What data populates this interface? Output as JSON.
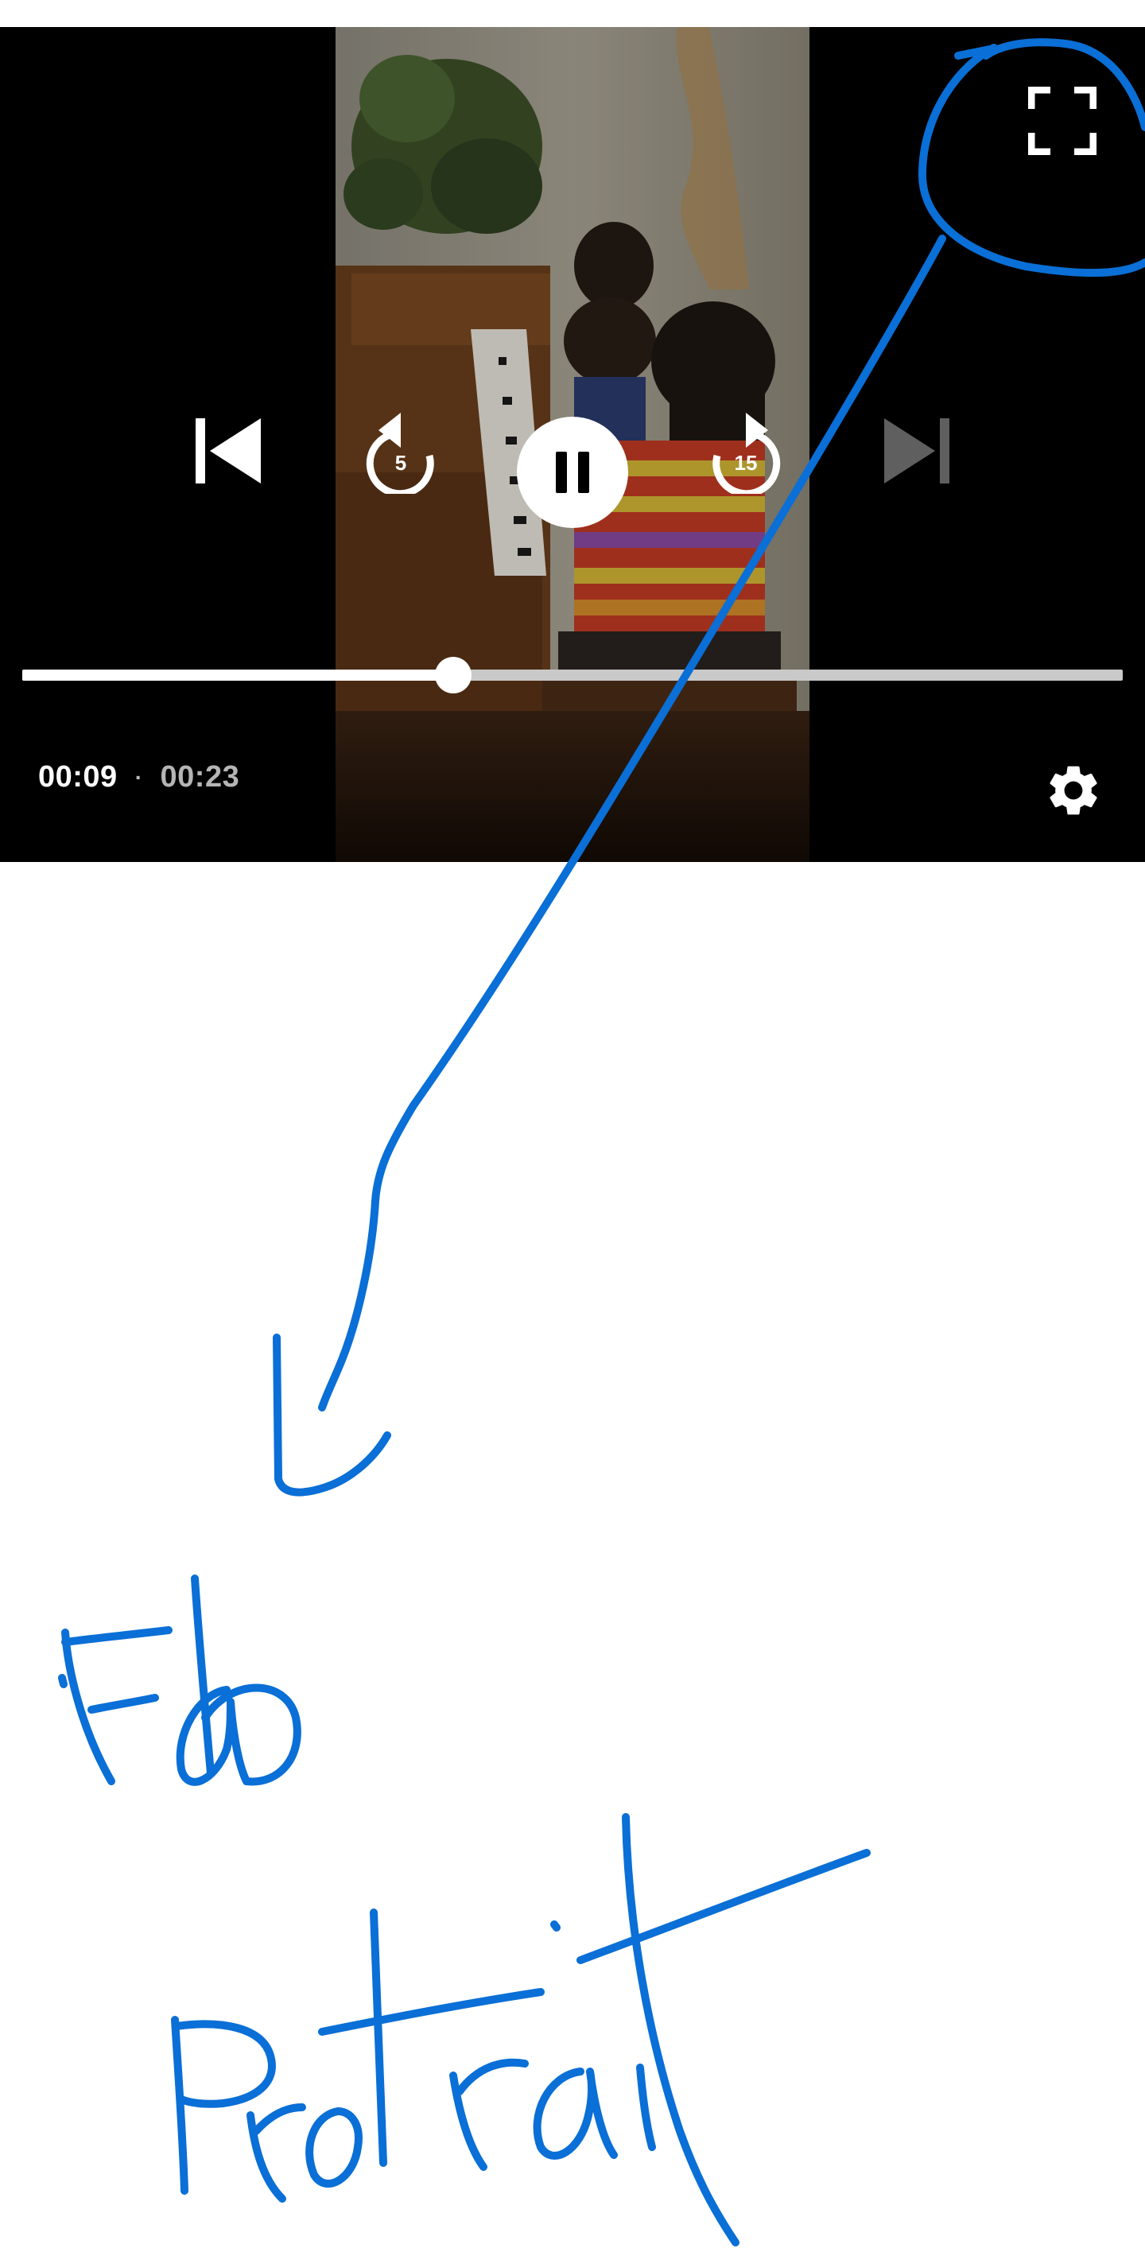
{
  "player": {
    "time_current": "00:09",
    "time_separator": "·",
    "time_total": "00:23",
    "progress_fraction": 0.3913,
    "rewind_seconds": "5",
    "forward_seconds": "15",
    "state": "playing",
    "controls": {
      "previous": "skip-previous-icon",
      "rewind": "replay-5-icon",
      "play_pause": "pause-icon",
      "forward": "forward-15-icon",
      "next": "skip-next-icon (disabled)",
      "fullscreen": "fullscreen-icon",
      "settings": "gear-icon"
    }
  },
  "annotation": {
    "color": "#0a6fd6",
    "handwritten_text": [
      "Fab",
      "Portrait"
    ]
  },
  "colors": {
    "player_background": "#000000",
    "control_active": "#ffffff",
    "control_disabled": "#5f5f5f",
    "ink": "#0a6fd6"
  }
}
